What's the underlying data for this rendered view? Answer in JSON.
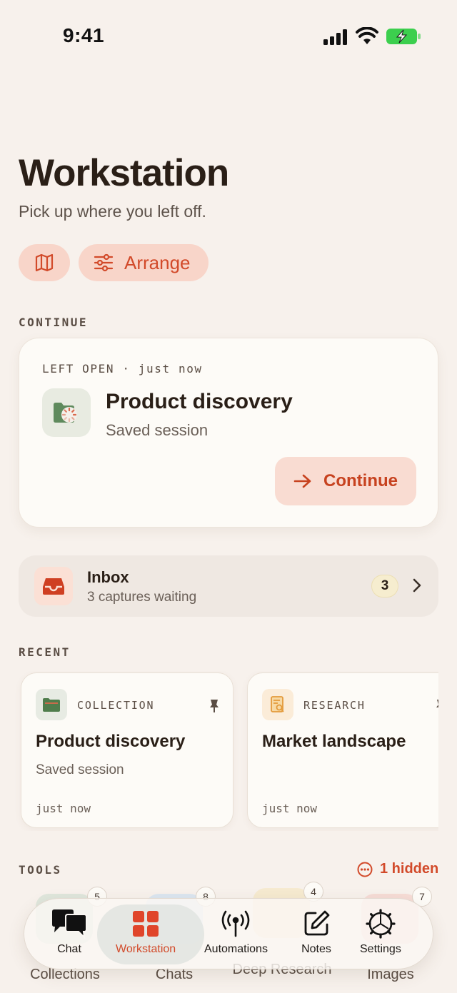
{
  "status_bar": {
    "time": "9:41",
    "icons": [
      "cellular-signal-icon",
      "wifi-icon",
      "battery-charging-icon"
    ]
  },
  "header": {
    "title": "Workstation",
    "subtitle": "Pick up where you left off.",
    "chips": [
      {
        "icon": "map-icon"
      },
      {
        "icon": "sliders-icon",
        "label": "Arrange"
      }
    ]
  },
  "continue_section": {
    "label": "CONTINUE",
    "card": {
      "meta": "LEFT OPEN · just now",
      "title": "Product discovery",
      "subtitle": "Saved session",
      "icon": "folder-loading-icon",
      "button_label": "Continue"
    }
  },
  "inbox": {
    "title": "Inbox",
    "subtitle": "3 captures waiting",
    "count": "3",
    "icon": "inbox-tray-icon"
  },
  "recent_section": {
    "label": "RECENT",
    "items": [
      {
        "type": "COLLECTION",
        "title": "Product discovery",
        "subtitle": "Saved session",
        "time": "just now",
        "icon": "folder-icon",
        "pinned": true
      },
      {
        "type": "RESEARCH",
        "title": "Market landscape",
        "subtitle": "",
        "time": "just now",
        "icon": "research-doc-icon",
        "pinned": true
      }
    ]
  },
  "tools_section": {
    "label": "TOOLS",
    "hidden_label": "1 hidden",
    "items": [
      {
        "label": "Collections",
        "count": "5",
        "color": "#dfe6dc"
      },
      {
        "label": "Chats",
        "count": "8",
        "color": "#dce6f0"
      },
      {
        "label": "Deep Research",
        "count": "4",
        "color": "#f6ead0"
      },
      {
        "label": "Images",
        "count": "7",
        "color": "#f6dcd6"
      }
    ]
  },
  "tab_bar": {
    "tabs": [
      {
        "label": "Chat",
        "icon": "chat-bubbles-icon",
        "active": false
      },
      {
        "label": "Workstation",
        "icon": "grid-icon",
        "active": true
      },
      {
        "label": "Automations",
        "icon": "broadcast-icon",
        "active": false
      },
      {
        "label": "Notes",
        "icon": "compose-icon",
        "active": false
      },
      {
        "label": "Settings",
        "icon": "gear-icon",
        "active": false
      }
    ]
  },
  "colors": {
    "background": "#f7f1ec",
    "accent": "#d24a2a",
    "chip_bg": "#f8d5c9",
    "card_bg": "#fdfbf7"
  }
}
